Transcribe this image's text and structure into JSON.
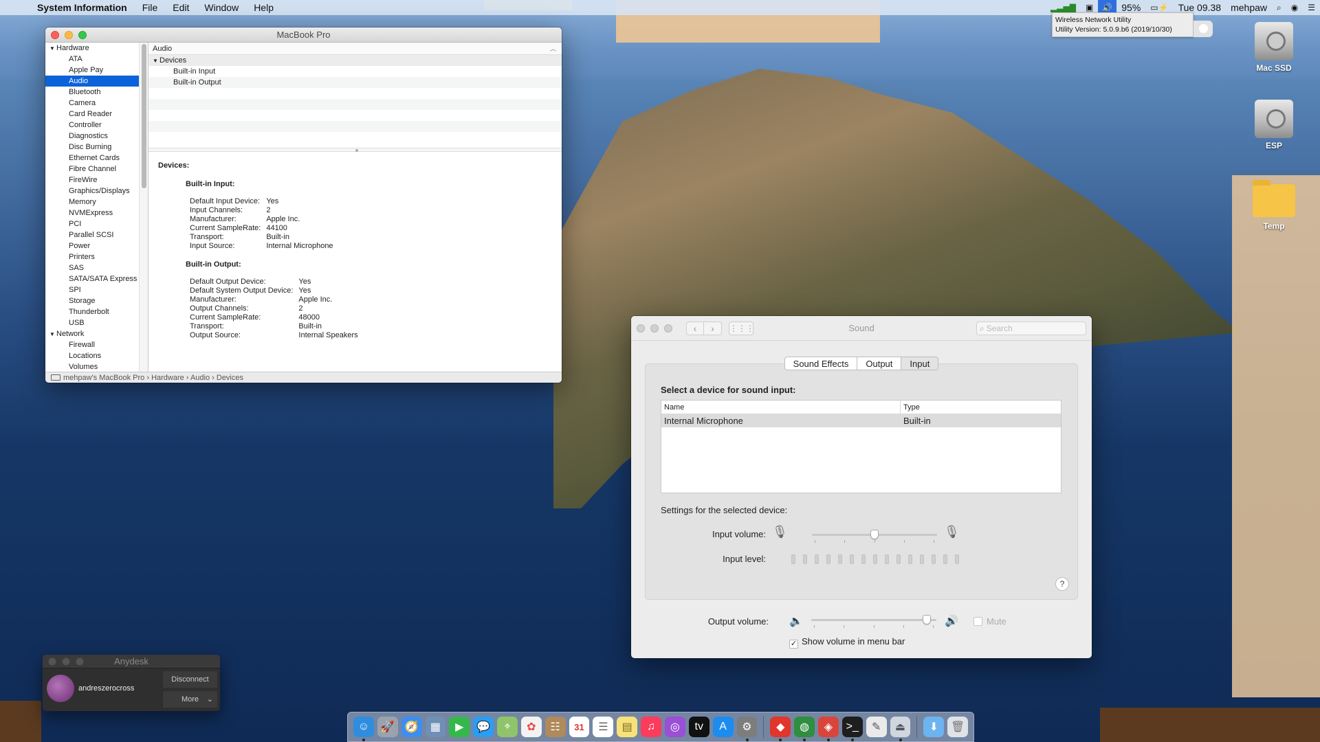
{
  "menubar": {
    "app_name": "System Information",
    "menus": [
      "File",
      "Edit",
      "Window",
      "Help"
    ],
    "battery": "95%",
    "clock": "Tue 09.38",
    "user": "mehpaw"
  },
  "tooltip": {
    "line1": "Wireless Network Utility",
    "line2": "Utility Version: 5.0.9.b6 (2019/10/30)"
  },
  "desktop_icons": [
    {
      "label": "Mac SSD"
    },
    {
      "label": "ESP"
    },
    {
      "label": "Temp"
    }
  ],
  "sysinfo": {
    "title": "MacBook Pro",
    "sidebar": {
      "hardware_group": "Hardware",
      "items": [
        "ATA",
        "Apple Pay",
        "Audio",
        "Bluetooth",
        "Camera",
        "Card Reader",
        "Controller",
        "Diagnostics",
        "Disc Burning",
        "Ethernet Cards",
        "Fibre Channel",
        "FireWire",
        "Graphics/Displays",
        "Memory",
        "NVMExpress",
        "PCI",
        "Parallel SCSI",
        "Power",
        "Printers",
        "SAS",
        "SATA/SATA Express",
        "SPI",
        "Storage",
        "Thunderbolt",
        "USB"
      ],
      "selected": "Audio",
      "network_group": "Network",
      "network_items": [
        "Firewall",
        "Locations",
        "Volumes"
      ]
    },
    "header": "Audio",
    "list": {
      "group": "Devices",
      "rows": [
        "Built-in Input",
        "Built-in Output"
      ]
    },
    "detail": {
      "title": "Devices:",
      "input_heading": "Built-in Input:",
      "input": [
        [
          "Default Input Device:",
          "Yes"
        ],
        [
          "Input Channels:",
          "2"
        ],
        [
          "Manufacturer:",
          "Apple Inc."
        ],
        [
          "Current SampleRate:",
          "44100"
        ],
        [
          "Transport:",
          "Built-in"
        ],
        [
          "Input Source:",
          "Internal Microphone"
        ]
      ],
      "output_heading": "Built-in Output:",
      "output": [
        [
          "Default Output Device:",
          "Yes"
        ],
        [
          "Default System Output Device:",
          "Yes"
        ],
        [
          "Manufacturer:",
          "Apple Inc."
        ],
        [
          "Output Channels:",
          "2"
        ],
        [
          "Current SampleRate:",
          "48000"
        ],
        [
          "Transport:",
          "Built-in"
        ],
        [
          "Output Source:",
          "Internal Speakers"
        ]
      ]
    },
    "status_path": [
      "mehpaw's MacBook Pro",
      "Hardware",
      "Audio",
      "Devices"
    ]
  },
  "sound": {
    "title": "Sound",
    "search_placeholder": "Search",
    "tabs": [
      "Sound Effects",
      "Output",
      "Input"
    ],
    "active_tab": "Input",
    "select_label": "Select a device for sound input:",
    "columns": [
      "Name",
      "Type"
    ],
    "devices": [
      {
        "name": "Internal Microphone",
        "type": "Built-in"
      }
    ],
    "settings_label": "Settings for the selected device:",
    "input_volume_label": "Input volume:",
    "input_volume_fraction": 0.5,
    "input_level_label": "Input level:",
    "output_volume_label": "Output volume:",
    "output_volume_fraction": 0.95,
    "mute_label": "Mute",
    "show_volume_label": "Show volume in menu bar",
    "show_volume_checked": true,
    "help_label": "?"
  },
  "anydesk": {
    "title": "Anydesk",
    "user": "andreszerocross",
    "disconnect": "Disconnect",
    "more": "More"
  },
  "dock": {
    "icons": [
      "finder-icon",
      "launchpad-icon",
      "safari-icon",
      "preview-icon",
      "facetime-icon",
      "messages-icon",
      "maps-icon",
      "photos-icon",
      "contacts-icon",
      "calendar-icon",
      "reminders-icon",
      "notes-icon",
      "music-icon",
      "podcasts-icon",
      "tv-icon",
      "app-store-icon",
      "system-preferences-icon",
      "anydesk-icon",
      "network-globe-icon",
      "git-icon",
      "terminal-icon",
      "script-editor-icon",
      "network-utility-icon",
      "downloads-folder-icon",
      "trash-icon"
    ],
    "calendar_day": "31"
  }
}
